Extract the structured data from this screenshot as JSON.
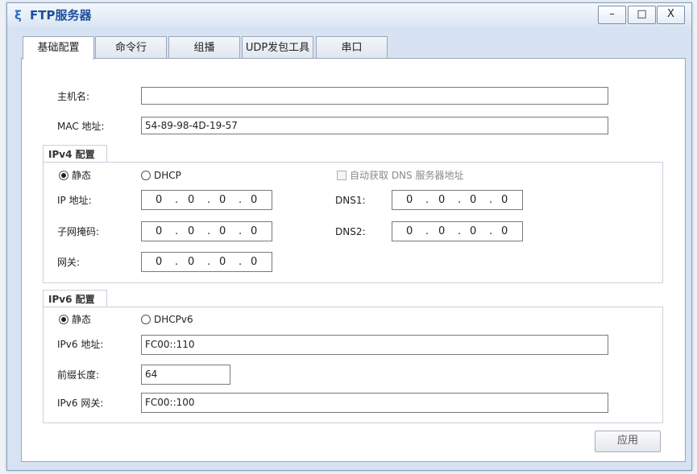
{
  "window": {
    "title": "FTP服务器",
    "minimize_label": "–",
    "maximize_label": "□",
    "close_label": "X"
  },
  "tabs": [
    {
      "label": "基础配置",
      "active": true
    },
    {
      "label": "命令行",
      "active": false
    },
    {
      "label": "组播",
      "active": false
    },
    {
      "label": "UDP发包工具",
      "active": false
    },
    {
      "label": "串口",
      "active": false
    }
  ],
  "basic": {
    "hostname_label": "主机名:",
    "hostname_value": "",
    "mac_label": "MAC 地址:",
    "mac_value": "54-89-98-4D-19-57"
  },
  "ipv4": {
    "group_title": "IPv4 配置",
    "static_label": "静态",
    "dhcp_label": "DHCP",
    "selected": "静态",
    "auto_dns_label": "自动获取 DNS 服务器地址",
    "ip_label": "IP 地址:",
    "ip_value": [
      "0",
      "0",
      "0",
      "0"
    ],
    "mask_label": "子网掩码:",
    "mask_value": [
      "0",
      "0",
      "0",
      "0"
    ],
    "gateway_label": "网关:",
    "gateway_value": [
      "0",
      "0",
      "0",
      "0"
    ],
    "dns1_label": "DNS1:",
    "dns1_value": [
      "0",
      "0",
      "0",
      "0"
    ],
    "dns2_label": "DNS2:",
    "dns2_value": [
      "0",
      "0",
      "0",
      "0"
    ]
  },
  "ipv6": {
    "group_title": "IPv6 配置",
    "static_label": "静态",
    "dhcp_label": "DHCPv6",
    "selected": "静态",
    "address_label": "IPv6 地址:",
    "address_value": "FC00::110",
    "prefix_label": "前缀长度:",
    "prefix_value": "64",
    "gateway_label": "IPv6 网关:",
    "gateway_value": "FC00::100"
  },
  "apply_label": "应用",
  "colors": {
    "title": "#1d4f9a",
    "window_bg": "#d7e3f3",
    "border": "#9aa8bb"
  }
}
